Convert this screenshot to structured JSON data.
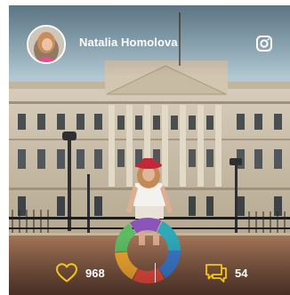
{
  "post": {
    "author_name": "Natalia Homolova",
    "likes": "968",
    "comments": "54"
  },
  "colors": {
    "accent": "#f5c518",
    "text": "#ffffff"
  },
  "icons": {
    "social": "instagram-icon",
    "like": "heart-icon",
    "comment": "comment-icon"
  }
}
